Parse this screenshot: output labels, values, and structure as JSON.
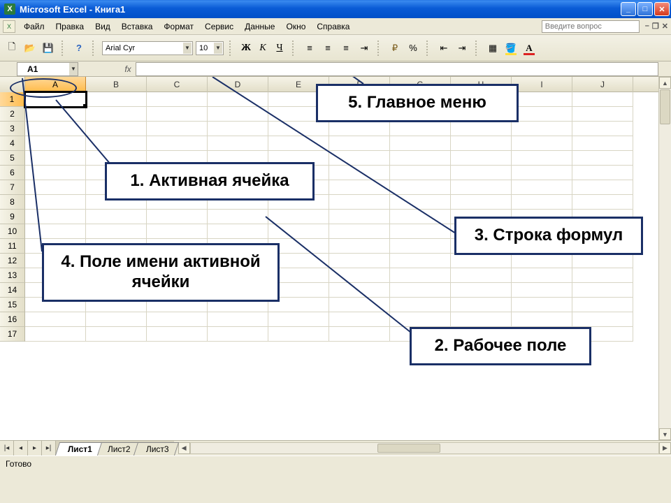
{
  "title": "Microsoft Excel - Книга1",
  "menu": {
    "file": "Файл",
    "edit": "Правка",
    "view": "Вид",
    "insert": "Вставка",
    "format": "Формат",
    "tools": "Сервис",
    "data": "Данные",
    "window": "Окно",
    "help": "Справка"
  },
  "ask_placeholder": "Введите вопрос",
  "toolbar": {
    "font_name": "Arial Cyr",
    "font_size": "10",
    "bold": "Ж",
    "italic": "К",
    "underline": "Ч",
    "percent": "%"
  },
  "name_box": "A1",
  "fx_label": "fx",
  "columns": [
    "A",
    "B",
    "C",
    "D",
    "E",
    "F",
    "G",
    "H",
    "I",
    "J"
  ],
  "rows": [
    1,
    2,
    3,
    4,
    5,
    6,
    7,
    8,
    9,
    10,
    11,
    12,
    13,
    14,
    15,
    16,
    17
  ],
  "active_cell": {
    "col": "A",
    "row": 1
  },
  "sheets": {
    "s1": "Лист1",
    "s2": "Лист2",
    "s3": "Лист3"
  },
  "status": "Готово",
  "callouts": {
    "c1": "1.  Активная ячейка",
    "c2": "2. Рабочее поле",
    "c3": "3. Строка формул",
    "c4": "4. Поле имени активной ячейки",
    "c5": "5. Главное меню"
  }
}
